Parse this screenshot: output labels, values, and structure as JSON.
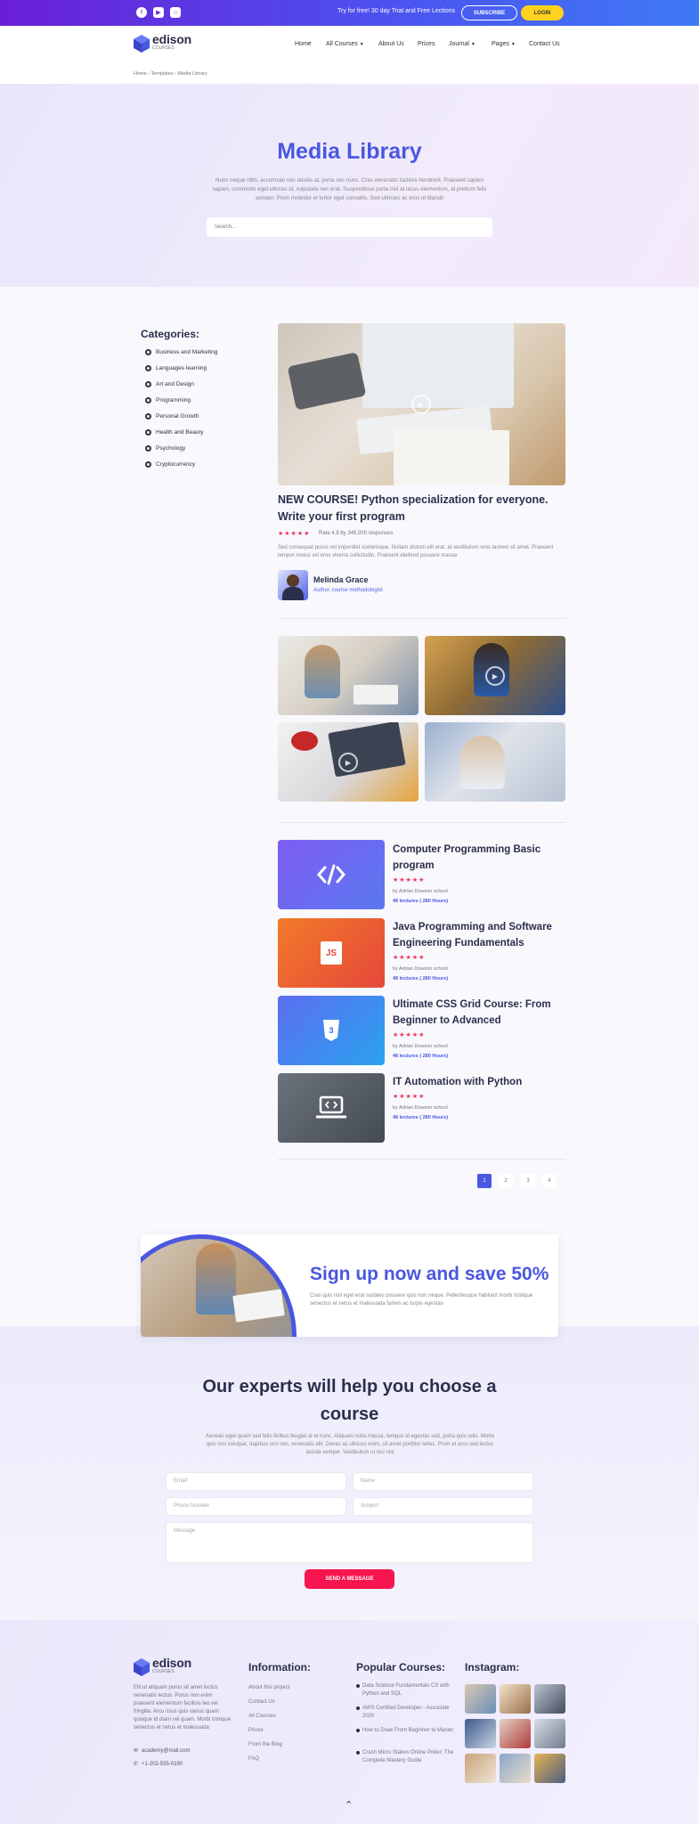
{
  "topbar": {
    "promo": "Try for free! 30 day Trial and Free Lections",
    "subscribe_label": "SUBSCRIBE",
    "login_label": "LOGIN"
  },
  "brand": {
    "name": "edison",
    "sub": "COURSES"
  },
  "nav": {
    "items": [
      "Home",
      "All Courses",
      "About Us",
      "Prices",
      "Journal",
      "Pages",
      "Contact Us"
    ]
  },
  "breadcrumb": "Home › Templates › Media Library",
  "hero": {
    "title": "Media Library",
    "text": "Nunc neque nibh, accumsan nec iaculis at, porta nec nunc. Cras venenatis facilisis hendrerit. Praesent sapien sapien, commodo eget ultrices id, vulputate nec erat. Suspendisse porta nisl at lacus elementum, at pretium felis semper. Proin molestie et tortor eget convallis. Sed ultricies ac eros ut blandit",
    "search_placeholder": "Search..."
  },
  "categories": {
    "title": "Categories:",
    "items": [
      "Business and Marketing",
      "Languages learning",
      "Art and Design",
      "Programming",
      "Personal Growth",
      "Health and Beauty",
      "Psychology",
      "Cryptocurrency"
    ]
  },
  "featured": {
    "title": "NEW COURSE! Python specialization for everyone. Write your first program",
    "stars": "★★★★★",
    "rating": 4.8,
    "rating_text": "Rate 4.8 by 345,000 responses",
    "description": "Sed consequat purus vel imperdiet scelerisque. Nullam dictum elit erat, at vestibulum eros laoreet sit amet. Praesent tempor metus vel eros viverra sollicitudin. Praesent eleifend posuere massa",
    "author_name": "Melinda Grace",
    "author_role": "Author, course methodologist"
  },
  "courses": [
    {
      "title": "Computer Programming Basic program",
      "by": "by Adrian Dowson school",
      "lectures": "48 lectures ( 280 Hours)",
      "icon": "code-icon",
      "color": "#6a5af0"
    },
    {
      "title": "Java Programming and Software Engineering Fundamentals",
      "by": "by Adrian Dowson school",
      "lectures": "48 lectures ( 280 Hours)",
      "icon": "js-icon",
      "color": "#f0622a"
    },
    {
      "title": "Ultimate CSS Grid Course: From Beginner to Advanced",
      "by": "by Adrian Dowson school",
      "lectures": "48 lectures ( 280 Hours)",
      "icon": "css3-icon",
      "color": "#3b86f0"
    },
    {
      "title": "IT Automation with Python",
      "by": "by Adrian Dowson school",
      "lectures": "48 lectures ( 280 Hours)",
      "icon": "laptop-code-icon",
      "color": "#5a6270"
    }
  ],
  "course_stars": "★★★★★",
  "pagination": {
    "pages": [
      "1",
      "2",
      "3",
      "4"
    ],
    "current": "1"
  },
  "signup": {
    "title": "Sign up now and save 50%",
    "text": "Cras quis nisl eget erat sodales posuere quis non neque. Pellentesque habitant morbi tristique senectus et netus et malesuada fames ac turpis egestas"
  },
  "experts": {
    "title": "Our experts will help you choose a course",
    "text": "Aenean eget quam sed felis finibus feugiat at et nunc. Aliquam nulla massa, tempus id egestas sed, porta quis odio. Morbi quis orci volutpat, dapibus orci nec, venenatis elit. Donec ac ultrices enim, sit amet porttitor tellus. Proin et arcu sed lectus lacinia semper. Vestibulum ut nisi nisl",
    "email_placeholder": "Email",
    "name_placeholder": "Name",
    "phone_placeholder": "Phone Number",
    "subject_placeholder": "Subject",
    "message_placeholder": "Message",
    "send_label": "SEND A MESSAGE"
  },
  "footer": {
    "about": "Elit ut aliquam purus sit amet luctus venenatis lectus. Purus non enim praesent elementum facilisis leo vel fringilla. Arcu risus quis varius quam quisque id diam vel quam. Morbi tristique senectus et netus et malesuada",
    "email": "academy@mail.com",
    "phone": "+1-202-555-0190",
    "info_title": "Information:",
    "info_links": [
      "About this project",
      "Contact Us",
      "All Courses",
      "Prices",
      "From the Blog",
      "FAQ"
    ],
    "popular_title": "Popular Courses:",
    "popular": [
      "Data Science Fundamentals CS with Python and SQL",
      "AWS Certified Developer - Associate 2020",
      "How to Draw From Beginner to Master",
      "Crash Micro Stakes Online Poker: The Complete Mastery Guide"
    ],
    "instagram_title": "Instagram:"
  },
  "colors": {
    "accent": "#4a57e0",
    "star": "#f0345a",
    "cta": "#f7154f",
    "login": "#ffd21f"
  }
}
